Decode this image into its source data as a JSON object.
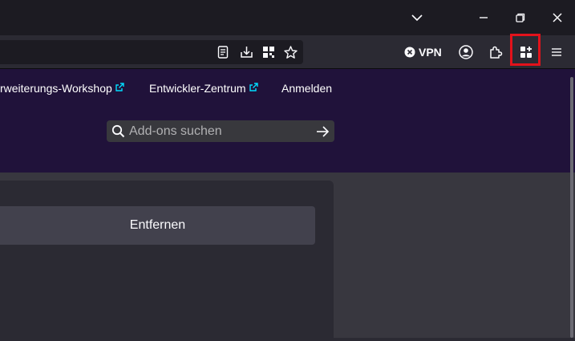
{
  "toolbar": {
    "vpn_label": "VPN"
  },
  "header": {
    "nav": [
      {
        "label": "rweiterungs-Workshop",
        "external": true
      },
      {
        "label": "Entwickler-Zentrum",
        "external": true
      },
      {
        "label": "Anmelden",
        "external": false
      }
    ],
    "search": {
      "placeholder": "Add-ons suchen"
    }
  },
  "card": {
    "remove_label": "Entfernen"
  },
  "colors": {
    "highlight": "#e3121b",
    "header_bg": "#20123a",
    "external_link": "#00ddff"
  }
}
